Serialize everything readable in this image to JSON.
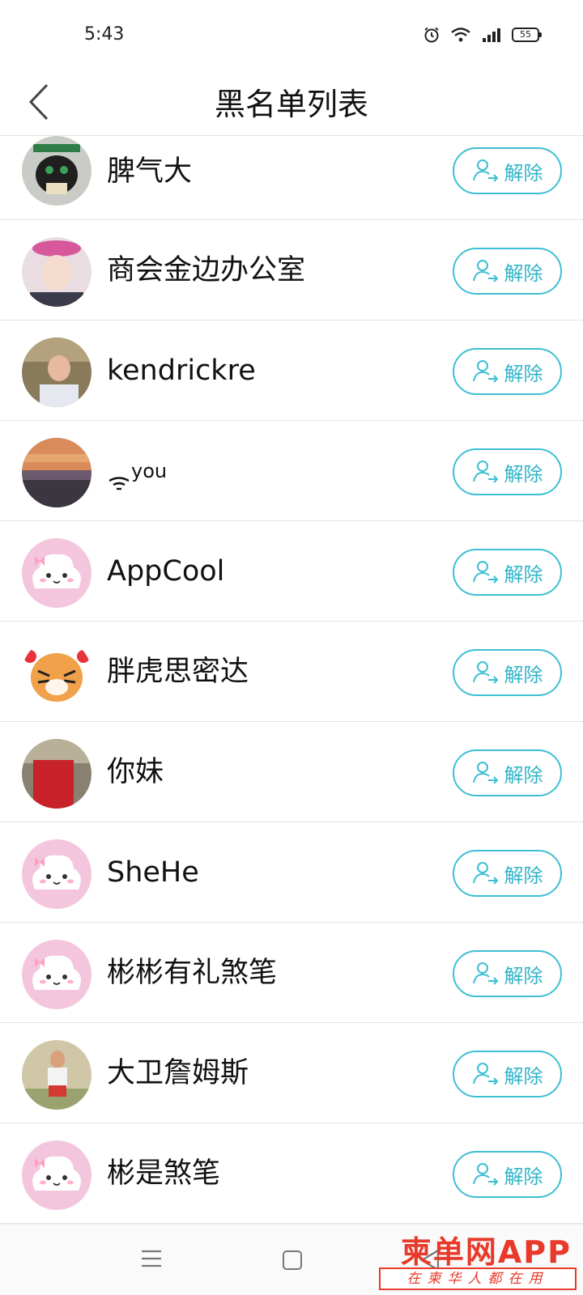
{
  "status_bar": {
    "time": "5:43",
    "battery": "55"
  },
  "header": {
    "title": "黑名单列表"
  },
  "icons": {
    "back": "back-chevron-icon",
    "remove": "user-arrow-icon"
  },
  "colors": {
    "accent": "#3dbfd3",
    "watermark": "#e83a2b"
  },
  "list": {
    "items": [
      {
        "name": "脾气大",
        "action": "解除",
        "avatar": "cat-avatar"
      },
      {
        "name": "商会金边办公室",
        "action": "解除",
        "avatar": "woman-avatar"
      },
      {
        "name": "kendrickre",
        "action": "解除",
        "avatar": "man-avatar"
      },
      {
        "name": "you",
        "action": "解除",
        "avatar": "sunset-avatar"
      },
      {
        "name": "AppCool",
        "action": "解除",
        "avatar": "default-avatar"
      },
      {
        "name": "胖虎思密达",
        "action": "解除",
        "avatar": "tiger-avatar"
      },
      {
        "name": "你妹",
        "action": "解除",
        "avatar": "red-avatar"
      },
      {
        "name": "SheHe",
        "action": "解除",
        "avatar": "default-avatar"
      },
      {
        "name": "彬彬有礼煞笔",
        "action": "解除",
        "avatar": "default-avatar"
      },
      {
        "name": "大卫詹姆斯",
        "action": "解除",
        "avatar": "man-beach-avatar"
      },
      {
        "name": "彬是煞笔",
        "action": "解除",
        "avatar": "default-avatar"
      }
    ]
  },
  "watermark": {
    "title": "柬单网APP",
    "subtitle": "在柬华人都在用"
  }
}
